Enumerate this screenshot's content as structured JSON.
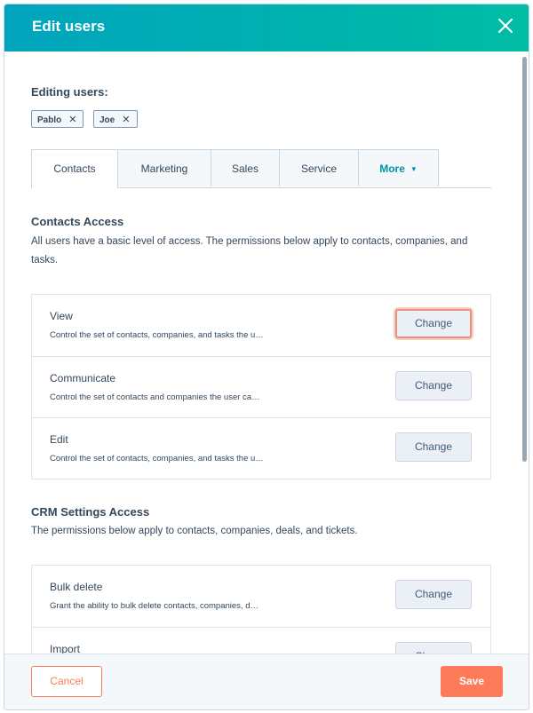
{
  "modal": {
    "title": "Edit users",
    "close_icon": "close-icon",
    "editing_label": "Editing users:",
    "users": [
      {
        "name": "Pablo",
        "remove_icon": "remove-icon"
      },
      {
        "name": "Joe",
        "remove_icon": "remove-icon"
      }
    ],
    "tabs": [
      {
        "label": "Contacts",
        "active": true
      },
      {
        "label": "Marketing"
      },
      {
        "label": "Sales"
      },
      {
        "label": "Service"
      },
      {
        "label": "More",
        "caret_icon": "caret-down-icon"
      }
    ],
    "contacts_section": {
      "title": "Contacts Access",
      "description": "All users have a basic level of access. The permissions below apply to contacts, companies, and tasks.",
      "permissions": [
        {
          "name": "View",
          "description": "Control the set of contacts, companies, and tasks the u…",
          "button": "Change"
        },
        {
          "name": "Communicate",
          "description": "Control the set of contacts and companies the user ca…",
          "button": "Change"
        },
        {
          "name": "Edit",
          "description": "Control the set of contacts, companies, and tasks the u…",
          "button": "Change"
        }
      ]
    },
    "crm_section": {
      "title": "CRM Settings Access",
      "description": "The permissions below apply to contacts, companies, deals, and tickets.",
      "permissions": [
        {
          "name": "Bulk delete",
          "description": "Grant the ability to bulk delete contacts, companies, d…",
          "button": "Change"
        },
        {
          "name": "Import",
          "description": "",
          "button": "Change"
        }
      ]
    },
    "footer": {
      "cancel_label": "Cancel",
      "save_label": "Save"
    },
    "colors": {
      "header_gradient_start": "#00a4bd",
      "header_gradient_end": "#00bda5",
      "primary_orange": "#ff7a59",
      "text": "#33475b",
      "link": "#0091ae"
    }
  }
}
